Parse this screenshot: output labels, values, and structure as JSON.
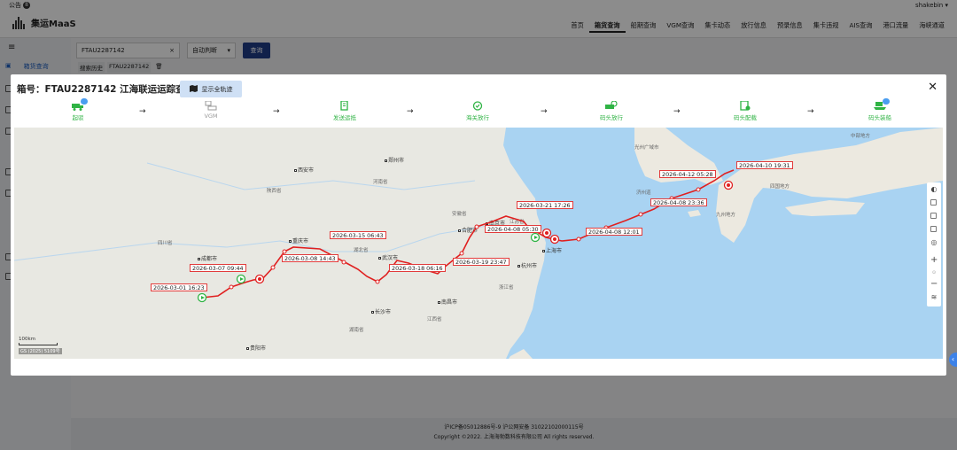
{
  "topstrip": {
    "notice_label": "公告",
    "notice_count": "8",
    "username": "shakebin"
  },
  "app": {
    "logo_text": "集运MaaS"
  },
  "nav": {
    "items": [
      "首页",
      "箱货查询",
      "船期查询",
      "VGM查询",
      "集卡动态",
      "放行信息",
      "预录信息",
      "集卡违规",
      "AIS查询",
      "港口流量",
      "海峡通道"
    ],
    "active_index": 1
  },
  "sidebar": {
    "active_item": "箱货查询"
  },
  "search": {
    "value": "FTAU2287142",
    "mode": "自动判断",
    "query_label": "查询",
    "history_label": "搜索历史",
    "history_tag": "FTAU2287142"
  },
  "modal": {
    "title": "箱号：FTAU2287142 江海联运运踪查询",
    "track_button": "显示全轨迹",
    "steps": [
      {
        "label": "起驳",
        "status": "done",
        "icon": "truck-icon",
        "badge": true
      },
      {
        "label": "VGM",
        "status": "pending",
        "icon": "scale-icon",
        "badge": false
      },
      {
        "label": "发送运抵",
        "status": "done",
        "icon": "document-icon",
        "badge": false
      },
      {
        "label": "海关放行",
        "status": "done",
        "icon": "customs-icon",
        "badge": false
      },
      {
        "label": "码头放行",
        "status": "done",
        "icon": "terminal-release-icon",
        "badge": false
      },
      {
        "label": "码头配载",
        "status": "done",
        "icon": "stowage-icon",
        "badge": false
      },
      {
        "label": "码头装船",
        "status": "done",
        "icon": "ship-loading-icon",
        "badge": true
      }
    ]
  },
  "map": {
    "timestamps": [
      "2026-03-01 16:23",
      "2026-03-07 09:44",
      "2026-03-08 14:43",
      "2026-03-15 06:43",
      "2026-03-18 06:16",
      "2026-03-19 23:47",
      "2026-03-21 17:26",
      "2026-04-08 05:30",
      "2026-04-08 12:01",
      "2026-04-08 23:36",
      "2026-04-12 05:28",
      "2026-04-10 19:31"
    ],
    "cities": [
      "郑州市",
      "西安市",
      "合肥市",
      "南京市",
      "成都市",
      "重庆市",
      "武汉市",
      "上海市",
      "杭州市",
      "长沙市",
      "南昌市",
      "贵阳市",
      "釜山"
    ],
    "regions": [
      "山西省",
      "河南省",
      "陕西省",
      "安徽省",
      "江苏省",
      "四川省",
      "湖北省",
      "浙江省",
      "江西省",
      "湖南省",
      "山东半岛",
      "中部地方",
      "四国地方",
      "九州地方",
      "济州道",
      "光州广域市",
      "济州岛"
    ],
    "scale_label": "100km",
    "copyright": "GS (2025) 5109号"
  },
  "footer": {
    "icp": "沪ICP备05012886号-9 沪公网安备 31022102000115号",
    "copyright": "Copyright ©2022. 上海海勃数科技有限公司 All rights reserved."
  },
  "colors": {
    "accent": "#1f3c88",
    "route": "#e02020",
    "step_done": "#2fb344",
    "step_pending": "#999999",
    "sea": "#a9d3f2"
  }
}
